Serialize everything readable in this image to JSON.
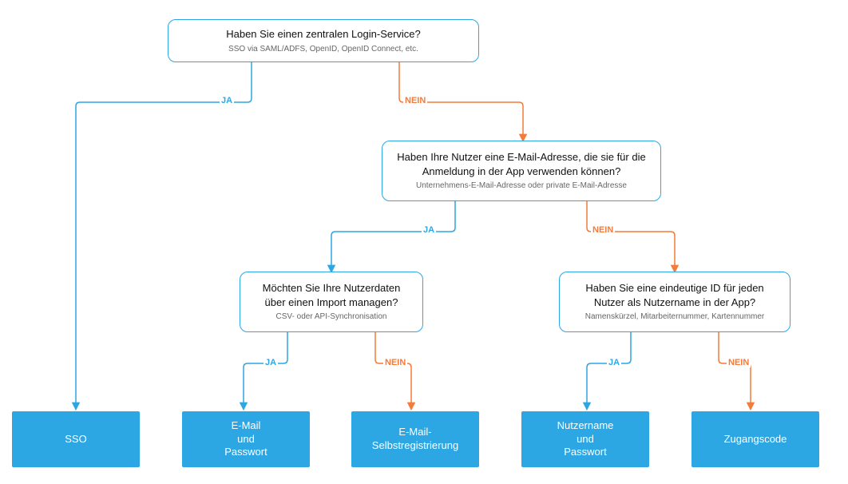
{
  "labels": {
    "yes": "JA",
    "no": "NEIN"
  },
  "colors": {
    "yes": "#2ca7e4",
    "no": "#f47b3a",
    "leaf_bg": "#2ca7e4"
  },
  "nodes": {
    "q1": {
      "title": "Haben Sie einen zentralen Login-Service?",
      "subtitle": "SSO via SAML/ADFS, OpenID, OpenID Connect, etc."
    },
    "q2": {
      "title": "Haben Ihre Nutzer eine E-Mail-Adresse, die sie für die Anmeldung in der App verwenden können?",
      "subtitle": "Unternehmens-E-Mail-Adresse oder private E-Mail-Adresse"
    },
    "q3": {
      "title": "Möchten Sie Ihre Nutzerdaten über einen Import managen?",
      "subtitle": "CSV- oder API-Synchronisation"
    },
    "q4": {
      "title": "Haben Sie eine eindeutige ID für jeden Nutzer als Nutzername in der App?",
      "subtitle": "Namenskürzel, Mitarbeiternummer, Kartennummer"
    }
  },
  "leaves": {
    "sso": "SSO",
    "email_pw_l1": "E-Mail",
    "email_pw_l2": "und",
    "email_pw_l3": "Passwort",
    "email_self_l1": "E-Mail-",
    "email_self_l2": "Selbstregistrierung",
    "user_pw_l1": "Nutzername",
    "user_pw_l2": "und",
    "user_pw_l3": "Passwort",
    "code": "Zugangscode"
  },
  "chart_data": {
    "type": "flowchart-decision-tree",
    "root": "q1",
    "edges": [
      {
        "from": "q1",
        "branch": "JA",
        "to": "leaf_sso"
      },
      {
        "from": "q1",
        "branch": "NEIN",
        "to": "q2"
      },
      {
        "from": "q2",
        "branch": "JA",
        "to": "q3"
      },
      {
        "from": "q2",
        "branch": "NEIN",
        "to": "q4"
      },
      {
        "from": "q3",
        "branch": "JA",
        "to": "leaf_email_password"
      },
      {
        "from": "q3",
        "branch": "NEIN",
        "to": "leaf_email_selfreg"
      },
      {
        "from": "q4",
        "branch": "JA",
        "to": "leaf_username_password"
      },
      {
        "from": "q4",
        "branch": "NEIN",
        "to": "leaf_accesscode"
      }
    ],
    "leaf_labels": {
      "leaf_sso": "SSO",
      "leaf_email_password": "E-Mail und Passwort",
      "leaf_email_selfreg": "E-Mail-Selbstregistrierung",
      "leaf_username_password": "Nutzername und Passwort",
      "leaf_accesscode": "Zugangscode"
    }
  }
}
